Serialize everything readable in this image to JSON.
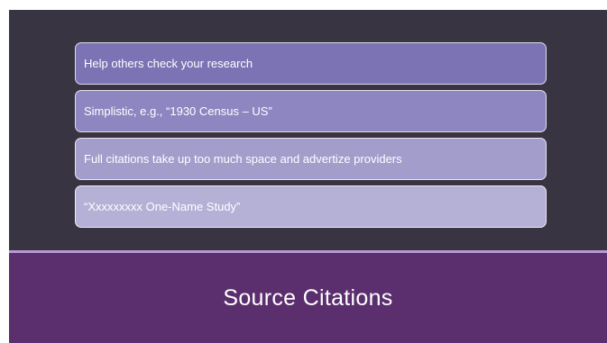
{
  "slide": {
    "bullets": [
      {
        "text": "Help others check your research"
      },
      {
        "text": "Simplistic, e.g., “1930 Census – US”"
      },
      {
        "text": "Full citations take up too much space and advertize providers"
      },
      {
        "text": "“Xxxxxxxxx One-Name Study”"
      }
    ],
    "title": "Source Citations"
  },
  "colors": {
    "slide_background": "#383442",
    "title_band": "#5b2f6e",
    "accent_line": "#b89ad6",
    "bullet_1": "#7b73b3",
    "bullet_2": "#8d86c0",
    "bullet_3": "#a29dcb",
    "bullet_4": "#b4b0d6"
  }
}
